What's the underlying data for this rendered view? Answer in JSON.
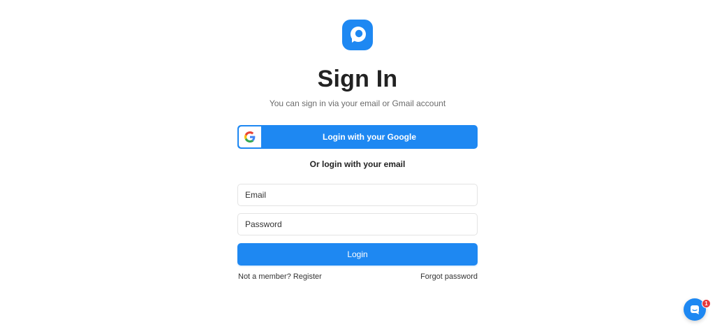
{
  "brand": {
    "logo_icon": "chat-bubble-p-logo-icon",
    "accent_color": "#1e88f2"
  },
  "header": {
    "title": "Sign In",
    "subtitle": "You can sign in via your email or Gmail account"
  },
  "google_login": {
    "icon": "google-g-icon",
    "label": "Login with your Google"
  },
  "divider": {
    "text": "Or login with your email"
  },
  "form": {
    "email": {
      "placeholder": "Email",
      "value": ""
    },
    "password": {
      "placeholder": "Password",
      "value": ""
    },
    "submit_label": "Login"
  },
  "links": {
    "register": "Not a member? Register",
    "forgot": "Forgot password"
  },
  "chat_widget": {
    "icon": "chat-icon",
    "badge_count": "1",
    "badge_color": "#e5383b"
  }
}
